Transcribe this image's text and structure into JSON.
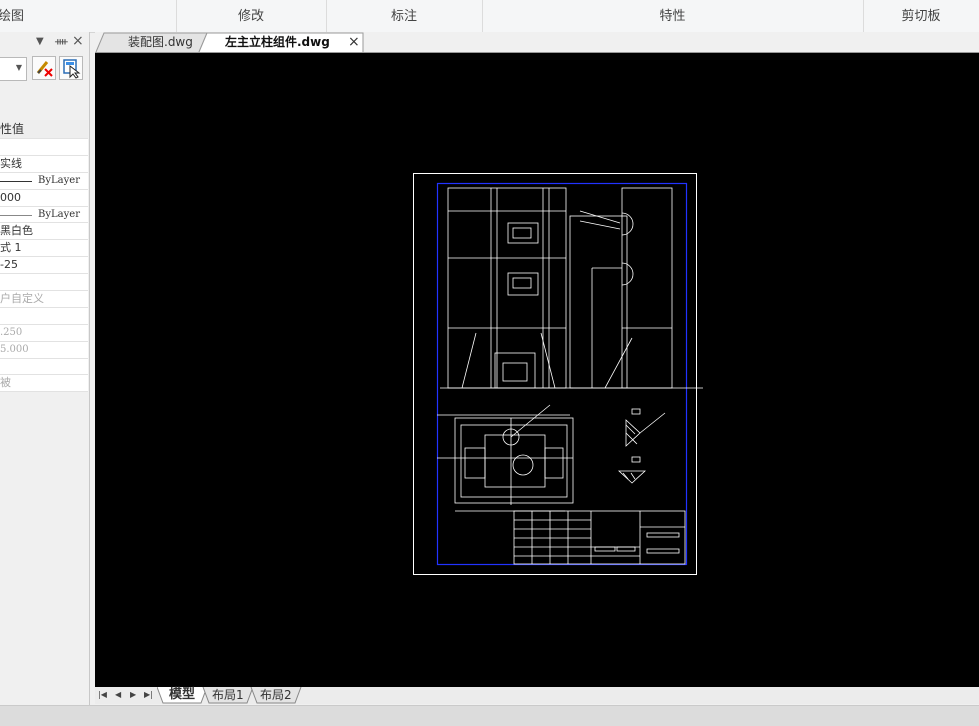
{
  "ribbon": {
    "groups": [
      "绘图",
      "修改",
      "标注",
      "特性",
      "剪切板"
    ]
  },
  "properties_panel": {
    "header_icons": [
      "chevron-down-icon",
      "pin-icon",
      "close-icon"
    ],
    "tools": [
      "clear-selection-icon",
      "select-objects-icon"
    ],
    "value_column_label": "性值",
    "rows": [
      "",
      "实线",
      "ByLayer",
      "000",
      "ByLayer",
      "黑白色",
      "式 1",
      "-25",
      "",
      "户自定义",
      "",
      ".250",
      "5.000",
      "",
      "被"
    ]
  },
  "document_tabs": [
    {
      "label": "装配图.dwg",
      "active": false
    },
    {
      "label": "左主立柱组件.dwg",
      "active": true,
      "close": "×"
    }
  ],
  "layout_tabs": [
    "模型",
    "布局1",
    "布局2"
  ],
  "nav_buttons": [
    "first-icon",
    "prev-icon",
    "next-icon",
    "last-icon"
  ],
  "colors": {
    "canvas_bg": "#000000",
    "sheet_border": "#ffffff",
    "drawing_frame": "#1a1aff",
    "drawing_lines": "#ffffff"
  }
}
